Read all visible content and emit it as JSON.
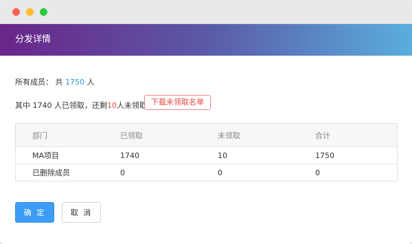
{
  "window": {
    "controls": [
      "close",
      "minimize",
      "maximize"
    ]
  },
  "header": {
    "title": "分发详情",
    "gradient": [
      "#6a2589",
      "#5aaede"
    ]
  },
  "summary": {
    "members_prefix": "所有成员：  共",
    "members_total": "1750",
    "members_suffix": "人",
    "claimed_prefix": "其中 1740 人已领取，还剩",
    "remaining": "10",
    "remaining_suffix": "人未领取"
  },
  "download_button": {
    "label": "下载未领取名单"
  },
  "table": {
    "headers": [
      "部门",
      "已领取",
      "未领取",
      "合计"
    ],
    "rows": [
      [
        "MA项目",
        "1740",
        "10",
        "1750"
      ],
      [
        "已删除成员",
        "0",
        "0",
        "0"
      ]
    ]
  },
  "actions": {
    "confirm_label": "确 定",
    "cancel_label": "取 消"
  },
  "colors": {
    "accent_blue": "#2b9bd6",
    "accent_red": "#e5483f",
    "primary_button": "#3d9cf5"
  }
}
